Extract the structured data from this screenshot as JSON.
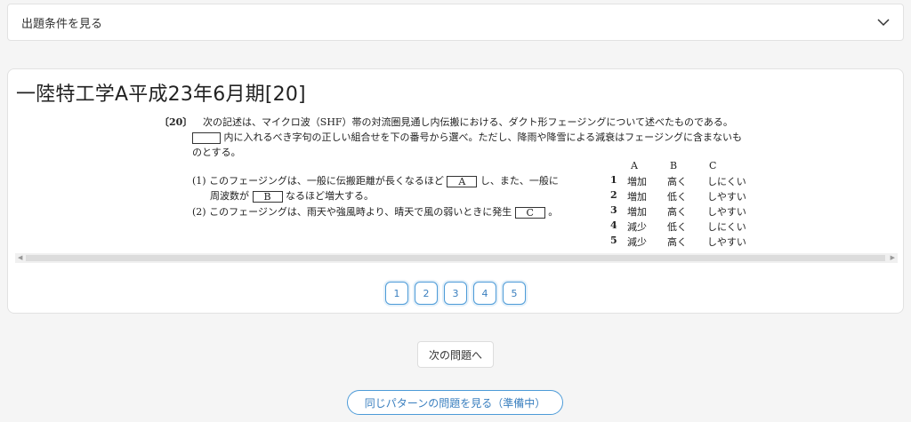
{
  "accordion": {
    "label": "出題条件を見る"
  },
  "question": {
    "title": "一陸特工学A平成23年6月期[20]",
    "number": "〔20〕",
    "intro_line1": "次の記述は、マイクロ波（SHF）帯の対流圏見通し内伝搬における、ダクト形フェージングについて述べたものである。",
    "intro_line2": "内に入れるべき字句の正しい組合せを下の番号から選べ。ただし、降雨や降雪による減衰はフェージングに含まないも",
    "intro_line3": "のとする。",
    "item1_pre": "(1)  このフェージングは、一般に伝搬距離が長くなるほど",
    "item1_box": "A",
    "item1_post": "し、また、一般に",
    "item1b_pre": "周波数が",
    "item1b_box": "B",
    "item1b_post": "なるほど増大する。",
    "item2_pre": "(2)  このフェージングは、雨天や強風時より、晴天で風の弱いときに発生",
    "item2_box": "C",
    "item2_post": "。",
    "headers": [
      "A",
      "B",
      "C"
    ],
    "options": [
      {
        "num": "1",
        "a": "増加",
        "b": "高く",
        "c": "しにくい"
      },
      {
        "num": "2",
        "a": "増加",
        "b": "低く",
        "c": "しやすい"
      },
      {
        "num": "3",
        "a": "増加",
        "b": "高く",
        "c": "しやすい"
      },
      {
        "num": "4",
        "a": "減少",
        "b": "低く",
        "c": "しにくい"
      },
      {
        "num": "5",
        "a": "減少",
        "b": "高く",
        "c": "しやすい"
      }
    ]
  },
  "answer_buttons": [
    "1",
    "2",
    "3",
    "4",
    "5"
  ],
  "next_button": "次の問題へ",
  "pattern_button": "同じパターンの問題を見る（準備中）",
  "icons": {
    "accordion": "chevron-down-icon",
    "scroll_left": "scroll-left-arrow-icon",
    "scroll_right": "scroll-right-arrow-icon"
  },
  "colors": {
    "accent": "#4d9bd8",
    "accent_text": "#3a7fbf"
  }
}
